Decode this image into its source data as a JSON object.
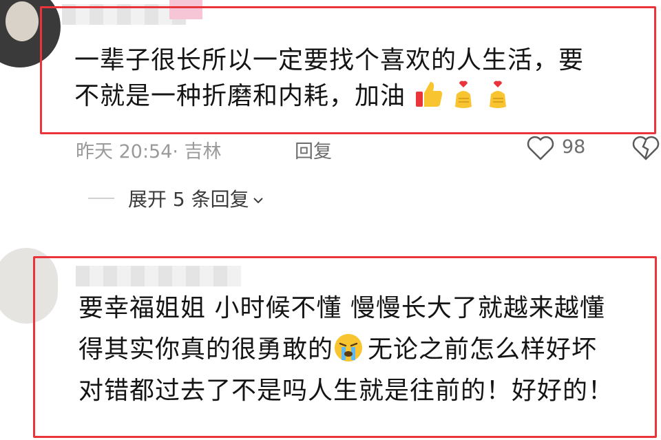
{
  "comment1": {
    "lines": [
      "一辈子很长所以一定要找个喜欢的人生活，要",
      "不就是一种折磨和内耗，加油"
    ],
    "emojis": [
      "thumbs-up-icon",
      "finger-heart-icon",
      "finger-heart-icon"
    ],
    "meta_time": "昨天 20:54· 吉林",
    "reply_label": "回复",
    "like_count": "98"
  },
  "expand": {
    "label": "展开 5 条回复"
  },
  "comment2": {
    "line1": "要幸福姐姐 小时候不懂 慢慢长大了就越来越懂",
    "line2_a": "得其实你真的很勇敢的",
    "line2_emoji": "crying-face-icon",
    "line2_b": "无论之前怎么样好坏",
    "line3": "对错都过去了不是吗人生就是往前的！好好的！"
  },
  "colors": {
    "highlight": "#e8343a",
    "meta": "#9a9a9a"
  }
}
